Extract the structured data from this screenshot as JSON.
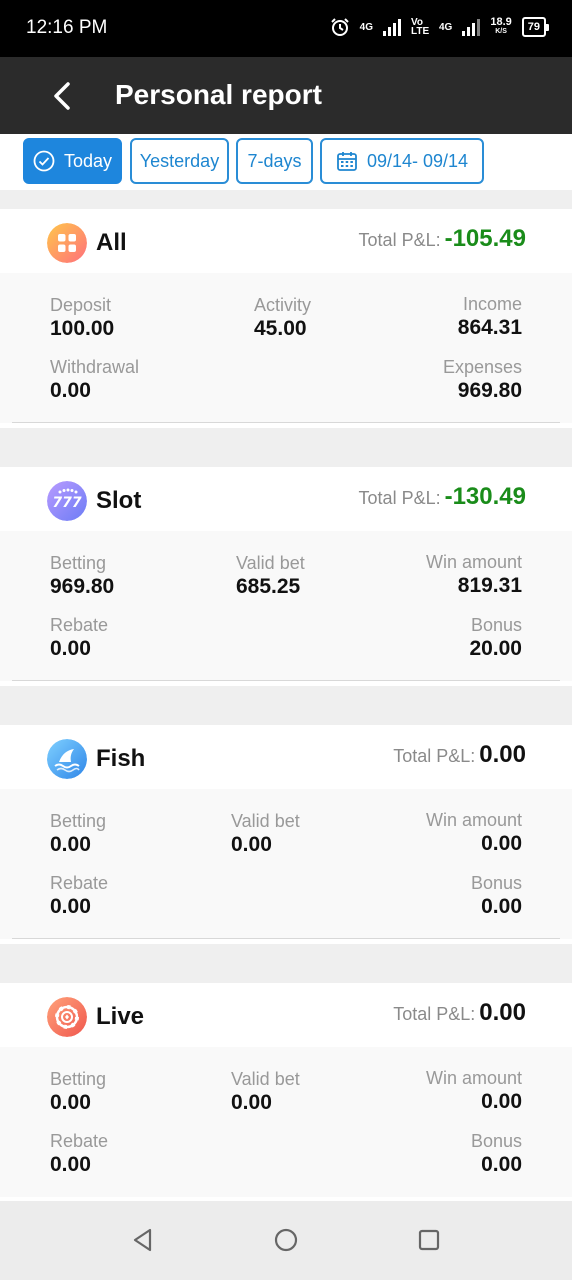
{
  "status_bar": {
    "time": "12:16 PM",
    "net1": "4G",
    "volte": "Vo LTE",
    "net2": "4G",
    "speed": "18.9",
    "speed_unit": "K/S",
    "battery": "79"
  },
  "header": {
    "title": "Personal report"
  },
  "filters": [
    {
      "label": "Today",
      "active": true
    },
    {
      "label": "Yesterday",
      "active": false
    },
    {
      "label": "7-days",
      "active": false
    },
    {
      "label": "09/14- 09/14",
      "active": false
    }
  ],
  "cards": [
    {
      "name": "All",
      "pl_label": "Total P&L:",
      "pl_value": "-105.49",
      "stats": [
        {
          "label": "Deposit",
          "value": "100.00"
        },
        {
          "label": "Activity",
          "value": "45.00"
        },
        {
          "label": "Income",
          "value": "864.31"
        },
        {
          "label": "Withdrawal",
          "value": "0.00"
        },
        {
          "label": "Expenses",
          "value": "969.80"
        }
      ]
    },
    {
      "name": "Slot",
      "pl_label": "Total P&L:",
      "pl_value": "-130.49",
      "stats": [
        {
          "label": "Betting",
          "value": "969.80"
        },
        {
          "label": "Valid bet",
          "value": "685.25"
        },
        {
          "label": "Win amount",
          "value": "819.31"
        },
        {
          "label": "Rebate",
          "value": "0.00"
        },
        {
          "label": "Bonus",
          "value": "20.00"
        }
      ]
    },
    {
      "name": "Fish",
      "pl_label": "Total P&L:",
      "pl_value": "0.00",
      "stats": [
        {
          "label": "Betting",
          "value": "0.00"
        },
        {
          "label": "Valid bet",
          "value": "0.00"
        },
        {
          "label": "Win amount",
          "value": "0.00"
        },
        {
          "label": "Rebate",
          "value": "0.00"
        },
        {
          "label": "Bonus",
          "value": "0.00"
        }
      ]
    },
    {
      "name": "Live",
      "pl_label": "Total P&L:",
      "pl_value": "0.00",
      "stats": [
        {
          "label": "Betting",
          "value": "0.00"
        },
        {
          "label": "Valid bet",
          "value": "0.00"
        },
        {
          "label": "Win amount",
          "value": "0.00"
        },
        {
          "label": "Rebate",
          "value": "0.00"
        },
        {
          "label": "Bonus",
          "value": "0.00"
        }
      ]
    }
  ],
  "colors": {
    "accent": "#1e86dd",
    "loss": "#1a8c1a",
    "header": "#2b2b2b"
  },
  "icons": [
    "back-arrow-icon",
    "check-circle-icon",
    "calendar-icon",
    "all-grid-icon",
    "slot-777-icon",
    "fish-shark-icon",
    "live-chip-icon",
    "nav-back-icon",
    "nav-home-icon",
    "nav-recents-icon"
  ]
}
